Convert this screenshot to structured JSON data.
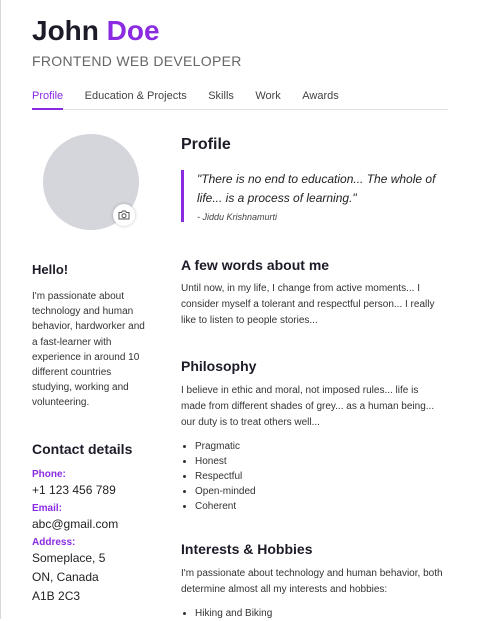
{
  "header": {
    "first_name": "John",
    "last_name": "Doe",
    "role": "FRONTEND WEB DEVELOPER"
  },
  "tabs": [
    {
      "label": "Profile",
      "active": true
    },
    {
      "label": "Education & Projects",
      "active": false
    },
    {
      "label": "Skills",
      "active": false
    },
    {
      "label": "Work",
      "active": false
    },
    {
      "label": "Awards",
      "active": false
    }
  ],
  "sidebar": {
    "hello_title": "Hello!",
    "hello_text": "I'm passionate about technology and human behavior, hardworker and a fast-learner with experience in around 10 different countries studying, working and volunteering.",
    "contact_title": "Contact details",
    "phone_label": "Phone:",
    "phone_value": "+1 123 456 789",
    "email_label": "Email:",
    "email_value": "abc@gmail.com",
    "address_label": "Address:",
    "address_line1": "Someplace, 5",
    "address_line2": "ON, Canada",
    "address_line3": "A1B 2C3"
  },
  "main": {
    "profile_title": "Profile",
    "quote_text": "\"There is no end to education... The whole of life... is a process of learning.\"",
    "quote_author": "- Jiddu Krishnamurti",
    "about_title": "A few words about me",
    "about_text": "Until now, in my life, I change from active moments... I consider myself a tolerant and respectful person... I really like to listen to people stories...",
    "philosophy_title": "Philosophy",
    "philosophy_text": "I believe in ethic and moral, not imposed rules... life is made from different shades of grey... as a human being... our duty is to treat others well...",
    "philosophy_items": [
      "Pragmatic",
      "Honest",
      "Respectful",
      "Open-minded",
      "Coherent"
    ],
    "interests_title": "Interests & Hobbies",
    "interests_text": "I'm passionate about technology and human behavior, both determine almost all my interests and hobbies:",
    "interests_items": [
      "Hiking and Biking"
    ]
  },
  "colors": {
    "accent": "#8a2be2",
    "avatar": "#d4d6dc"
  },
  "icons": {
    "camera": "camera-icon"
  }
}
